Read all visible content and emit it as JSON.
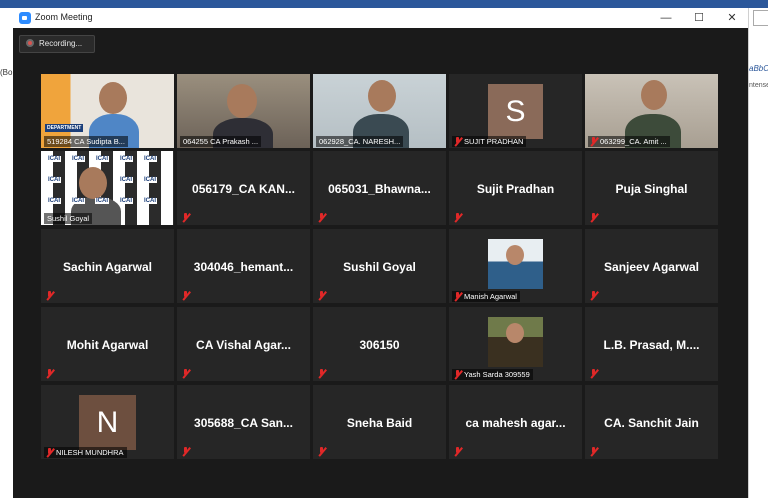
{
  "window": {
    "title": "Zoom Meeting",
    "controls": {
      "minimize": "—",
      "maximize": "☐",
      "close": "✕"
    }
  },
  "recording": {
    "label": "Recording..."
  },
  "background_app": {
    "left_text": "(Bo",
    "right_text_1": "aBbC",
    "right_text_2": "ntense"
  },
  "participants": [
    {
      "name": "519284 CA Sudipta B...",
      "type": "video",
      "muted": false,
      "banner": "DEPARTMENT"
    },
    {
      "name": "064255 CA Prakash ...",
      "type": "video",
      "muted": false
    },
    {
      "name": "062928_CA. NARESH...",
      "type": "video",
      "muted": false
    },
    {
      "name": "SUJIT PRADHAN",
      "type": "avatar",
      "initial": "S",
      "muted": true
    },
    {
      "name": "063299_CA. Amit ...",
      "type": "video",
      "muted": true
    },
    {
      "name": "Sushil Goyal",
      "type": "video",
      "muted": false,
      "active_speaker": true,
      "logo_text": "ICAI"
    },
    {
      "name": "056179_CA  KAN...",
      "type": "name",
      "muted": true
    },
    {
      "name": "065031_Bhawna...",
      "type": "name",
      "muted": true
    },
    {
      "name": "Sujit Pradhan",
      "type": "name",
      "muted": true
    },
    {
      "name": "Puja Singhal",
      "type": "name",
      "muted": true
    },
    {
      "name": "Sachin Agarwal",
      "type": "name",
      "muted": true
    },
    {
      "name": "304046_hemant...",
      "type": "name",
      "muted": true
    },
    {
      "name": "Sushil Goyal",
      "type": "name",
      "muted": true
    },
    {
      "name": "Manish Agarwal",
      "type": "photo",
      "muted": true
    },
    {
      "name": "Sanjeev Agarwal",
      "type": "name",
      "muted": true
    },
    {
      "name": "Mohit Agarwal",
      "type": "name",
      "muted": true
    },
    {
      "name": "CA  Vishal  Agar...",
      "type": "name",
      "muted": true
    },
    {
      "name": "306150",
      "type": "name",
      "muted": true
    },
    {
      "name": "Yash Sarda 309559",
      "type": "photo",
      "muted": true
    },
    {
      "name": "L.B.  Prasad,  M....",
      "type": "name",
      "muted": true
    },
    {
      "name": "NILESH MUNDHRA",
      "type": "avatar",
      "initial": "N",
      "muted": true
    },
    {
      "name": "305688_CA  San...",
      "type": "name",
      "muted": true
    },
    {
      "name": "Sneha Baid",
      "type": "name",
      "muted": true
    },
    {
      "name": "ca  mahesh  agar...",
      "type": "name",
      "muted": true
    },
    {
      "name": "CA.  Sanchit Jain",
      "type": "name",
      "muted": true
    }
  ],
  "colors": {
    "tile_bg": "#262626",
    "window_bg": "#1a1a1a",
    "active_border": "#e5e53a",
    "mute_red": "#e02828",
    "zoom_blue": "#2d8cff"
  }
}
